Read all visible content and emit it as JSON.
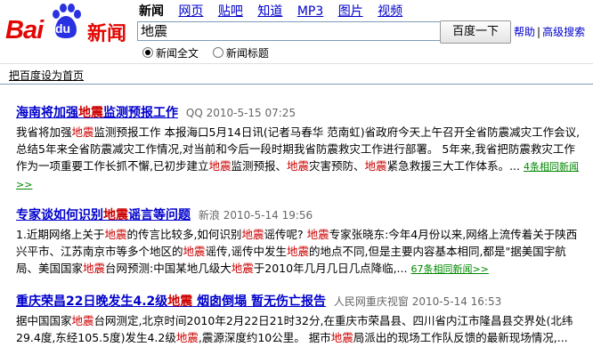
{
  "logo": {
    "bai": "Bai",
    "du": "du",
    "news": "新闻"
  },
  "tabs": [
    "新闻",
    "网页",
    "贴吧",
    "知道",
    "MP3",
    "图片",
    "视频"
  ],
  "search": {
    "query": "地震",
    "button": "百度一下"
  },
  "help_links": {
    "help": "帮助",
    "sep": "|",
    "advanced": "高级搜索"
  },
  "radios": {
    "full_text": "新闻全文",
    "title_only": "新闻标题"
  },
  "set_home": "把百度设为首页",
  "results": [
    {
      "title_pre": "海南将加强",
      "title_hl": "地震",
      "title_post": "监测预报工作",
      "source": "QQ 2010-5-15 07:25",
      "snippet": [
        {
          "t": "我省将加强"
        },
        {
          "t": "地震",
          "hl": true
        },
        {
          "t": "监测预报工作 本报海口5月14日讯(记者马春华 范南虹)省政府今天上午召开全省防震减灾工作会议,总结5年来全省防震减灾工作情况,对当前和今后一段时期我省防震救灾工作进行部署。 5年来,我省把防震救灾工作作为一项重要工作长抓不懈,已初步建立"
        },
        {
          "t": "地震",
          "hl": true
        },
        {
          "t": "监测预报、"
        },
        {
          "t": "地震",
          "hl": true
        },
        {
          "t": "灾害预防、"
        },
        {
          "t": "地震",
          "hl": true
        },
        {
          "t": "紧急救援三大工作体系。..."
        }
      ],
      "more": "4条相同新闻>>"
    },
    {
      "title_pre": "专家谈如何识别",
      "title_hl": "地震",
      "title_post": "谣言等问题",
      "source": "新浪 2010-5-14 19:56",
      "snippet": [
        {
          "t": "1.近期网络上关于"
        },
        {
          "t": "地震",
          "hl": true
        },
        {
          "t": "的传言比较多,如何识别"
        },
        {
          "t": "地震",
          "hl": true
        },
        {
          "t": "谣传呢? "
        },
        {
          "t": "地震",
          "hl": true
        },
        {
          "t": "专家张晓东:今年4月份以来,网络上流传着关于陕西兴平市、江苏南京市等多个地区的"
        },
        {
          "t": "地震",
          "hl": true
        },
        {
          "t": "谣传,谣传中发生"
        },
        {
          "t": "地震",
          "hl": true
        },
        {
          "t": "的地点不同,但是主要内容基本相同,都是\"据美国宇航局、美国国家"
        },
        {
          "t": "地震",
          "hl": true
        },
        {
          "t": "台网预测:中国某地几级大"
        },
        {
          "t": "地震",
          "hl": true
        },
        {
          "t": "于2010年几月几日几点降临,..."
        }
      ],
      "more": "67条相同新闻>>"
    },
    {
      "title_pre": "重庆荣昌22日晚发生4.2级",
      "title_hl": "地震",
      "title_post": " 烟囱倒塌 暂无伤亡报告",
      "source": "人民网重庆视窗 2010-5-14 16:53",
      "snippet": [
        {
          "t": "据中国国家"
        },
        {
          "t": "地震",
          "hl": true
        },
        {
          "t": "台网测定,北京时间2010年2月22日21时32分,在重庆市荣昌县、四川省内江市隆昌县交界处(北纬29.4度,东经105.5度)发生4.2级"
        },
        {
          "t": "地震",
          "hl": true
        },
        {
          "t": ",震源深度约10公里。 据市"
        },
        {
          "t": "地震",
          "hl": true
        },
        {
          "t": "局派出的现场工作队反馈的最新现场情况,..."
        }
      ],
      "more": ""
    }
  ],
  "colors": {
    "link": "#0000cc",
    "highlight": "#cc0000",
    "more": "#008000",
    "logo_red": "#e10602",
    "logo_blue": "#2932e1"
  }
}
